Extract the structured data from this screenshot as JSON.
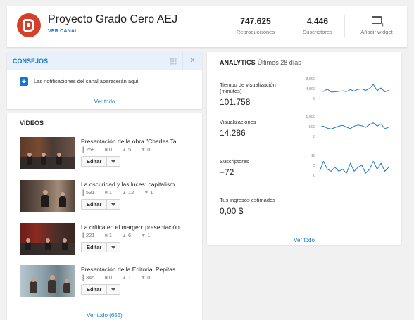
{
  "header": {
    "channel_title": "Proyecto Grado Cero AEJ",
    "ver_canal": "VER CANAL",
    "reproducciones_value": "747.625",
    "reproducciones_label": "Reproducciones",
    "suscriptores_value": "4.446",
    "suscriptores_label": "Suscriptores",
    "widget_label": "Añadir widget"
  },
  "consejos": {
    "title": "CONSEJOS",
    "notification_text": "Las notificaciones del canal aparecerán aquí.",
    "ver_todo": "Ver todo"
  },
  "videos": {
    "title": "VÍDEOS",
    "edit_label": "Editar",
    "ver_todo": "Ver todo (655)",
    "items": [
      {
        "title": "Presentación de la obra \"Charles Ta...",
        "views": "258",
        "comments": "0",
        "likes": "5",
        "dislikes": "0"
      },
      {
        "title": "La oscuridad y las luces: capitalism...",
        "views": "531",
        "comments": "1",
        "likes": "12",
        "dislikes": "1"
      },
      {
        "title": "La crítica en el margen: presentación",
        "views": "221",
        "comments": "1",
        "likes": "6",
        "dislikes": "1"
      },
      {
        "title": "Presentación de la Editorial Pepitas ...",
        "views": "345",
        "comments": "0",
        "likes": "1",
        "dislikes": "0"
      }
    ]
  },
  "analytics": {
    "title": "ANALYTICS",
    "period": "Últimos 28 días",
    "ver_todo": "Ver todo",
    "metrics": [
      {
        "label_line1": "Tiempo de visualización",
        "label_line2": "(minutos)",
        "value": "101.758",
        "ticks": [
          "8,000",
          "4,000",
          "0"
        ],
        "ymax": 8000,
        "series": [
          3100,
          2900,
          3800,
          2600,
          2700,
          2900,
          3100,
          2800,
          3600,
          3000,
          3700,
          3900,
          3300,
          4100,
          5700,
          3200,
          4300,
          2700,
          3300
        ]
      },
      {
        "label_line1": "Visualizaciones",
        "label_line2": "",
        "value": "14.286",
        "ticks": [
          "1,000",
          "500",
          "0"
        ],
        "ymax": 1000,
        "series": [
          470,
          520,
          420,
          380,
          450,
          520,
          560,
          470,
          400,
          520,
          580,
          540,
          460,
          600,
          690,
          520,
          640,
          390,
          470
        ]
      },
      {
        "label_line1": "Suscriptores",
        "label_line2": "",
        "value": "+72",
        "ticks": [
          "10",
          "5",
          "0"
        ],
        "ymax": 10,
        "series": [
          2,
          7,
          3,
          2,
          4,
          2,
          3,
          1,
          6,
          2,
          4,
          5,
          1,
          3,
          7,
          3,
          6,
          2,
          4
        ]
      },
      {
        "label_line1": "Tus ingresos estimados",
        "label_line2": "",
        "value": "0,00 $"
      }
    ],
    "line_color": "#1f77c4"
  }
}
